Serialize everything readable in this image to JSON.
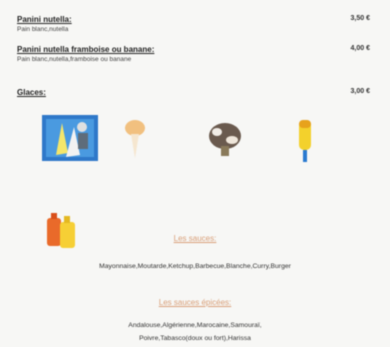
{
  "items": [
    {
      "title": "Panini nutella:",
      "desc": "Pain blanc,nutella",
      "price": "3,50 €"
    },
    {
      "title": "Panini nutella framboise ou banane:",
      "desc": "Pain blanc,nutella,framboise ou banane",
      "price": "4,00 €"
    }
  ],
  "glaces": {
    "title": "Glaces:",
    "price": "3,00 €"
  },
  "sauces": {
    "title": "Les sauces:",
    "list": "Mayonnaise,Moutarde,Ketchup,Barbecue,Blanche,Curry,Burger"
  },
  "sauces_epicees": {
    "title": "Les sauces épicées:",
    "line1": "Andalouse,Algérienne,Marocaine,Samouraï,",
    "line2": "Poivre,Tabasco(doux ou fort),Harissa"
  }
}
